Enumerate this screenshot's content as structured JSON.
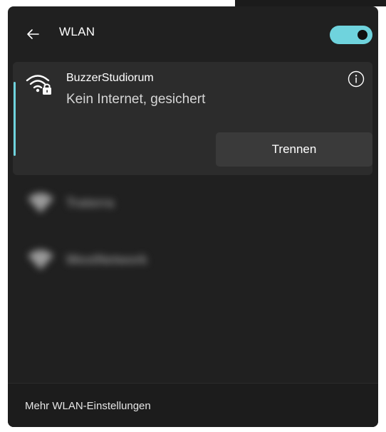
{
  "header": {
    "title": "WLAN",
    "back_icon": "back-arrow-icon",
    "wifi_toggle": {
      "on": true,
      "color": "#6fd3dd"
    }
  },
  "connected_network": {
    "name": "BuzzerStudiorum",
    "status": "Kein Internet, gesichert",
    "icon": "wifi-lock-icon",
    "info_icon": "info-icon",
    "disconnect_label": "Trennen"
  },
  "other_networks": [
    {
      "name": "Traterra",
      "icon": "wifi-icon"
    },
    {
      "name": "WestNetwork",
      "icon": "wifi-icon"
    }
  ],
  "footer": {
    "link_label": "Mehr WLAN-Einstellungen"
  }
}
